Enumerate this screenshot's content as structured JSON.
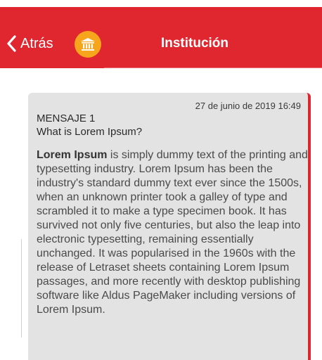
{
  "nav": {
    "back_label": "Atrás",
    "title": "Institución",
    "icon": "institution-icon",
    "bar_color": "#e0262e",
    "icon_color": "#f7a51d"
  },
  "message": {
    "date": "27 de junio de 2019 16:49",
    "number": "MENSAJE 1",
    "subject": "What is Lorem Ipsum?",
    "body_bold": "Lorem Ipsum",
    "body_rest": " is simply dummy text of the printing and typesetting industry. Lorem Ipsum has been the industry's standard dummy text ever since the 1500s, when an unknown printer took a galley of type and scrambled it to make a type specimen book. It has survived not only five centuries, but also the leap into electronic typesetting, remaining essentially unchanged. It was popularised in the 1960s with the release of Letraset sheets containing Lorem Ipsum passages, and more recently with desktop publishing software like Aldus PageMaker including versions of Lorem Ipsum.",
    "accent_color": "#e0262e"
  }
}
